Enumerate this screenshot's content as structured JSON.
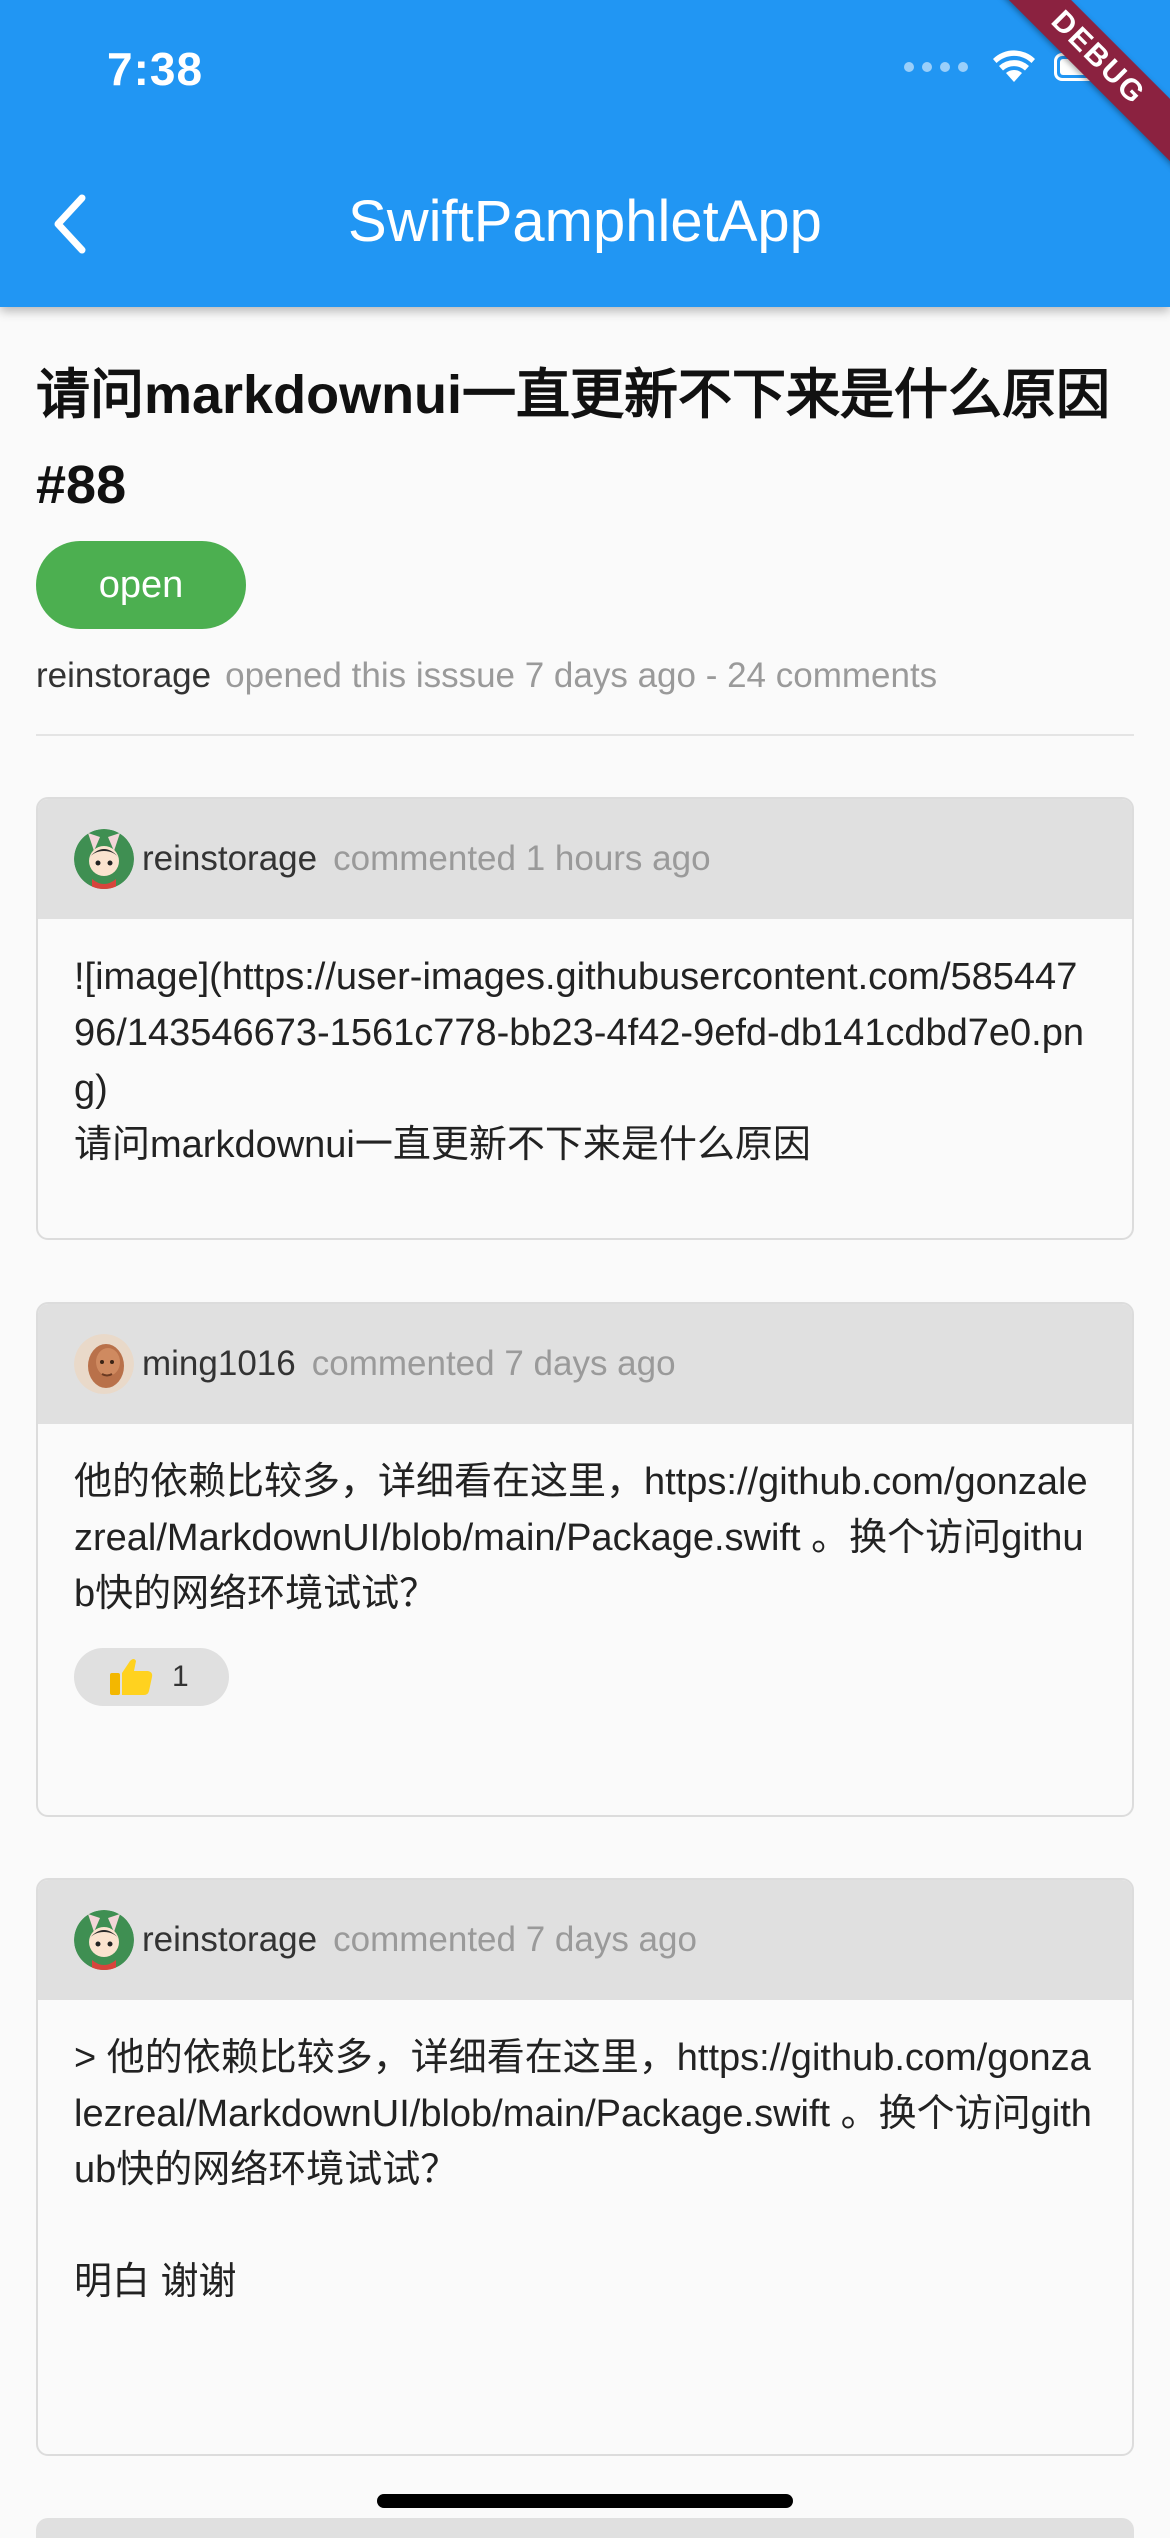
{
  "status_bar": {
    "time": "7:38",
    "debug_label": "DEBUG"
  },
  "app_bar": {
    "title": "SwiftPamphletApp",
    "back_icon": "chevron-left-icon"
  },
  "issue": {
    "title": "请问markdownui一直更新不下来是什么原因#88",
    "status": "open",
    "author": "reinstorage",
    "meta": "opened this isssue 7 days ago - 24 comments"
  },
  "comments": [
    {
      "author": "reinstorage",
      "time": "commented 1 hours ago",
      "body_lines": [
        "![image](https://user-images.githubusercontent.com/58544796/143546673-1561c778-bb23-4f42-9efd-db141cdbd7e0.png)",
        "请问markdownui一直更新不下来是什么原因"
      ]
    },
    {
      "author": "ming1016",
      "time": "commented 7 days ago",
      "body_lines": [
        "他的依赖比较多，详细看在这里，https://github.com/gonzalezreal/MarkdownUI/blob/main/Package.swift 。换个访问github快的网络环境试试？"
      ],
      "reaction": {
        "icon": "thumbs-up-icon",
        "count": "1"
      }
    },
    {
      "author": "reinstorage",
      "time": "commented 7 days ago",
      "body_lines": [
        "> 他的依赖比较多，详细看在这里，https://github.com/gonzalezreal/MarkdownUI/blob/main/Package.swift 。换个访问github快的网络环境试试？",
        "",
        "明白  谢谢"
      ]
    }
  ],
  "colors": {
    "app_bar": "#2196f3",
    "status_open": "#4caf50",
    "card_header": "#e0e0e0",
    "debug_ribbon": "#8b2240"
  }
}
